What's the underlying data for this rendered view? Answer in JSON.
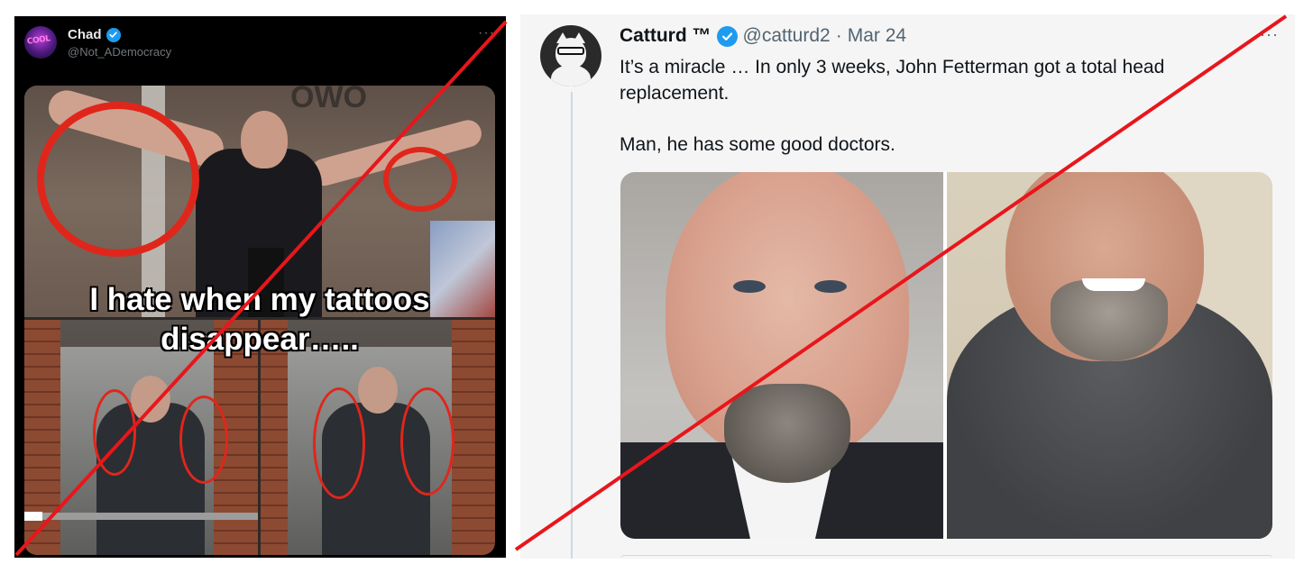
{
  "left_tweet": {
    "display_name": "Chad",
    "handle": "@Not_ADemocracy",
    "more_label": "···",
    "meme_caption_line1": "I hate when my tattoos",
    "meme_caption_line2": "disappear…..",
    "avatar_text": "COOL"
  },
  "right_tweet": {
    "display_name": "Catturd ™",
    "handle": "@catturd2",
    "separator": "·",
    "date": "Mar 24",
    "more_label": "···",
    "text_line1": "It’s a miracle … In only 3 weeks, John Fetterman got a total head replacement.",
    "text_line2": "Man, he has some good doctors."
  },
  "colors": {
    "verified_blue": "#1d9bf0",
    "strike_red": "#e8161b",
    "dark_bg": "#000000",
    "light_bg": "#f5f5f5"
  },
  "icons": {
    "verified": "verified-badge-icon",
    "more": "more-horizontal-icon"
  }
}
